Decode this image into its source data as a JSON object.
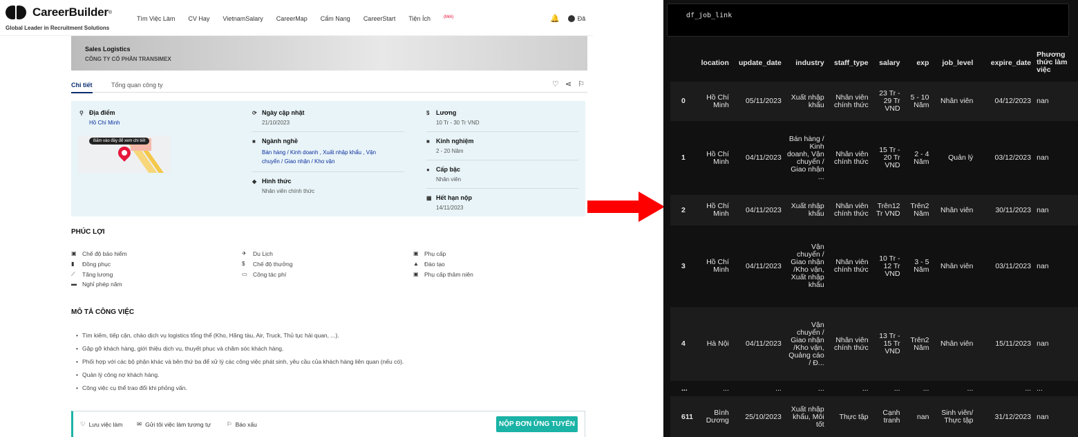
{
  "header": {
    "logo": "CareerBuilder",
    "logo_mark": "®",
    "tagline": "Global Leader in Recruitment Solutions",
    "nav": [
      "Tìm Việc Làm",
      "CV Hay",
      "VietnamSalary",
      "CareerMap",
      "Cẩm Nang",
      "CareerStart",
      "Tiện Ích"
    ],
    "nav_badge": "(Mới)",
    "user_cut": "Đă"
  },
  "banner": {
    "job_title": "Sales Logistics",
    "company": "CÔNG TY CỔ PHẦN TRANSIMEX"
  },
  "tabs": [
    "Chi tiết",
    "Tổng quan công ty"
  ],
  "info": {
    "location_label": "Địa điểm",
    "location_value": "Hồ Chí Minh",
    "map_tip": "Bấm vào đây để xem chi tiết",
    "updated_label": "Ngày cập nhật",
    "updated_value": "21/10/2023",
    "industry_label": "Ngành nghề",
    "industry_value": "Bán hàng / Kinh doanh , Xuất nhập khẩu , Vận chuyển / Giao nhận / Kho vận",
    "type_label": "Hình thức",
    "type_value": "Nhân viên chính thức",
    "salary_label": "Lương",
    "salary_value": "10 Tr - 30 Tr VND",
    "exp_label": "Kinh nghiệm",
    "exp_value": "2 - 20 Năm",
    "level_label": "Cấp bậc",
    "level_value": "Nhân viên",
    "deadline_label": "Hết hạn nộp",
    "deadline_value": "14/11/2023"
  },
  "benefits": {
    "title": "PHÚC LỢI",
    "col1": [
      "Chế độ bảo hiểm",
      "Đồng phục",
      "Tăng lương",
      "Nghỉ phép năm"
    ],
    "col2": [
      "Du Lịch",
      "Chế độ thưởng",
      "Công tác phí"
    ],
    "col3": [
      "Phụ cấp",
      "Đào tạo",
      "Phụ cấp thâm niên"
    ]
  },
  "description": {
    "title": "MÔ TẢ CÔNG VIỆC",
    "items": [
      "Tìm kiếm, tiếp cận, chào dịch vụ logistics tổng thể (Kho, Hãng tàu, Air, Truck, Thủ tục hải quan, ...).",
      "Gặp gỡ khách hàng, giới thiệu dịch vụ, thuyết phục và chăm sóc khách hàng.",
      "Phối hợp với các bộ phận khác và bên thứ ba để xử lý các công việc phát sinh, yêu cầu của khách hàng liên quan (nếu có).",
      "Quản lý công nợ khách hàng.",
      "Công việc cụ thể trao đổi khi phỏng vấn."
    ]
  },
  "bottom": {
    "save": "Lưu việc làm",
    "send": "Gửi tôi việc làm tương tự",
    "report": "Báo xấu",
    "apply": "NỘP ĐƠN ỨNG TUYỂN"
  },
  "notebook": {
    "code": "df_job_link",
    "columns": [
      "",
      "location",
      "update_date",
      "industry",
      "staff_type",
      "salary",
      "exp",
      "job_level",
      "expire_date",
      "Phương thức làm việc"
    ],
    "rows": [
      {
        "idx": "0",
        "location": "Hồ Chí Minh",
        "update_date": "05/11/2023",
        "industry": "Xuất nhập khẩu",
        "staff_type": "Nhân viên chính thức",
        "salary": "23 Tr - 29 Tr VND",
        "exp": "5 - 10 Năm",
        "job_level": "Nhân viên",
        "expire_date": "04/12/2023",
        "work": "nan"
      },
      {
        "idx": "1",
        "location": "Hồ Chí Minh",
        "update_date": "04/11/2023",
        "industry": "Bán hàng / Kinh doanh, Vận chuyển / Giao nhận ...",
        "staff_type": "Nhân viên chính thức",
        "salary": "15 Tr - 20 Tr VND",
        "exp": "2 - 4 Năm",
        "job_level": "Quản lý",
        "expire_date": "03/12/2023",
        "work": "nan"
      },
      {
        "idx": "2",
        "location": "Hồ Chí Minh",
        "update_date": "04/11/2023",
        "industry": "Xuất nhập khẩu",
        "staff_type": "Nhân viên chính thức",
        "salary": "Trên12 Tr VND",
        "exp": "Trên2 Năm",
        "job_level": "Nhân viên",
        "expire_date": "30/11/2023",
        "work": "nan"
      },
      {
        "idx": "3",
        "location": "Hồ Chí Minh",
        "update_date": "04/11/2023",
        "industry": "Vận chuyển / Giao nhận /Kho vận, Xuất nhập khẩu",
        "staff_type": "Nhân viên chính thức",
        "salary": "10 Tr - 12 Tr VND",
        "exp": "3 - 5 Năm",
        "job_level": "Nhân viên",
        "expire_date": "03/11/2023",
        "work": "nan"
      },
      {
        "idx": "4",
        "location": "Hà Nội",
        "update_date": "04/11/2023",
        "industry": "Vận chuyển / Giao nhận /Kho vận, Quảng cáo / Đ...",
        "staff_type": "Nhân viên chính thức",
        "salary": "13 Tr - 15 Tr VND",
        "exp": "Trên2 Năm",
        "job_level": "Nhân viên",
        "expire_date": "15/11/2023",
        "work": "nan"
      },
      {
        "idx": "...",
        "location": "...",
        "update_date": "...",
        "industry": "...",
        "staff_type": "...",
        "salary": "...",
        "exp": "...",
        "job_level": "...",
        "expire_date": "...",
        "work": "..."
      },
      {
        "idx": "611",
        "location": "Bình Dương",
        "update_date": "25/10/2023",
        "industry": "Xuất nhập khẩu, Môi tốt",
        "staff_type": "Thực tập",
        "salary": "Cạnh tranh",
        "exp": "nan",
        "job_level": "Sinh viên/ Thực tập",
        "expire_date": "31/12/2023",
        "work": "nan"
      }
    ]
  },
  "colors": {
    "accent": "#1ab3a6",
    "navy": "#0a2d6e",
    "arrow": "#ff0000",
    "info_bg": "#e8f4f8"
  }
}
